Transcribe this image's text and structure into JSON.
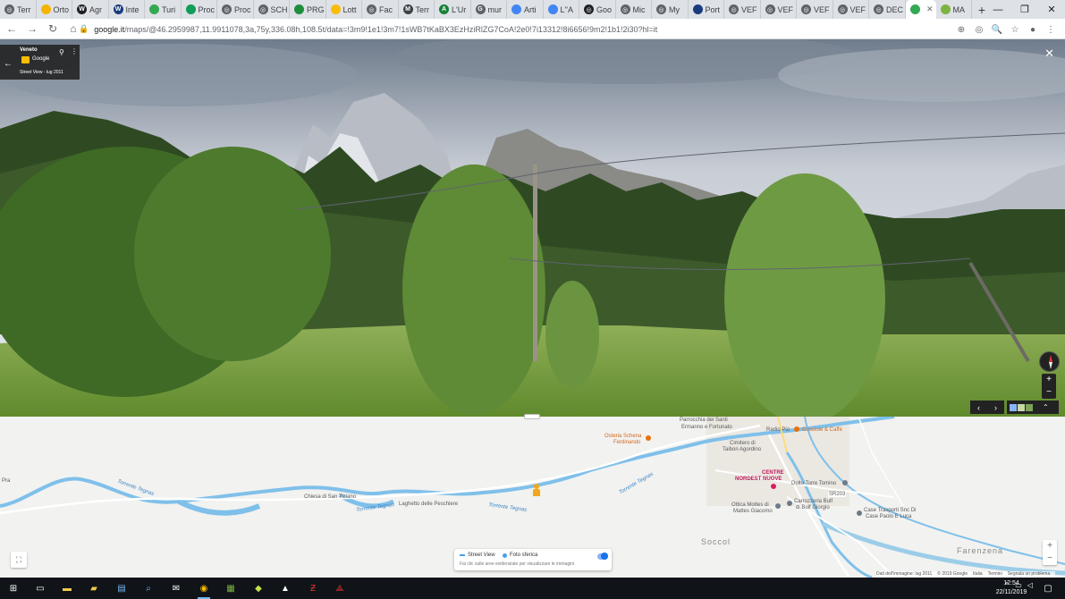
{
  "browser": {
    "tabs": [
      {
        "label": "Terr",
        "color": "#5f6368",
        "glyph": "◎"
      },
      {
        "label": "Orto",
        "color": "#f4b400",
        "glyph": ""
      },
      {
        "label": "Agr",
        "color": "#202124",
        "glyph": "W"
      },
      {
        "label": "Inte",
        "color": "#1a3b7d",
        "glyph": "W"
      },
      {
        "label": "Turi",
        "color": "#34a853",
        "glyph": ""
      },
      {
        "label": "Proc",
        "color": "#0f9d58",
        "glyph": ""
      },
      {
        "label": "Proc",
        "color": "#5f6368",
        "glyph": "◎"
      },
      {
        "label": "SCH",
        "color": "#5f6368",
        "glyph": "◎"
      },
      {
        "label": "PRG",
        "color": "#1e8e3e",
        "glyph": ""
      },
      {
        "label": "Lott",
        "color": "#fbbc04",
        "glyph": ""
      },
      {
        "label": "Fac",
        "color": "#5f6368",
        "glyph": "◎"
      },
      {
        "label": "Terr",
        "color": "#3c4043",
        "glyph": "M"
      },
      {
        "label": "L'Ur",
        "color": "#188038",
        "glyph": "A"
      },
      {
        "label": "mur",
        "color": "#5f6368",
        "glyph": "G"
      },
      {
        "label": "Arti",
        "color": "#4285f4",
        "glyph": ""
      },
      {
        "label": "L''A",
        "color": "#4285f4",
        "glyph": ""
      },
      {
        "label": "Goo",
        "color": "#202124",
        "glyph": "◎"
      },
      {
        "label": "Mic",
        "color": "#5f6368",
        "glyph": "◎"
      },
      {
        "label": "My",
        "color": "#5f6368",
        "glyph": "◎"
      },
      {
        "label": "Port",
        "color": "#1a3b7d",
        "glyph": ""
      },
      {
        "label": "VEF",
        "color": "#5f6368",
        "glyph": "◎"
      },
      {
        "label": "VEF",
        "color": "#5f6368",
        "glyph": "◎"
      },
      {
        "label": "VEF",
        "color": "#5f6368",
        "glyph": "◎"
      },
      {
        "label": "VEF",
        "color": "#5f6368",
        "glyph": "◎"
      },
      {
        "label": "DEC",
        "color": "#5f6368",
        "glyph": "◎"
      }
    ],
    "active_tab": {
      "label": "",
      "color": "#34a853"
    },
    "last_tab": {
      "label": "MA",
      "color": "#7cb342"
    },
    "new_tab_glyph": "+",
    "url_host": "google.it",
    "url_rest": "/maps/@46.2959987,11.9911078,3a,75y,336.08h,108.5t/data=!3m9!1e1!3m7!1sWB7tKaBX3EzHziRlZG7CoA!2e0!7i13312!8i6656!9m2!1b1!2i30?hl=it"
  },
  "streetview": {
    "place": "Veneto",
    "by": "Google",
    "date": "Street View - lug 2011"
  },
  "map": {
    "labels": {
      "pra": "Pra",
      "torrente_tegnas_1": "Torrente Tegnas",
      "chiesa": "Chiesa di San Tiziano",
      "torrente_tegnas_2": "Torrente Tegnas",
      "laghetto": "Laghetto delle Peschiere",
      "torrente_tegnas_3": "Torrente Tegnas",
      "torrente_tegnas_4": "Torrente Tegnas",
      "osteria_1": "Osteria Schena",
      "osteria_2": "Ferdinando",
      "parrocchia_1": "Parrocchia dei Santi",
      "parrocchia_2": "Ermanno e Fortunato",
      "cimitero_1": "Cimitero di",
      "cimitero_2": "Taibon Agordino",
      "radio": "Radio Più",
      "gocciole": "Gocciole & Caffè",
      "centre_1": "CENTRE",
      "centre_2": "NORDEST NUOVE",
      "dolto": "Dolto Torre Tomino",
      "sr203": "SR203",
      "bulf": "Carrozzeria Bulf",
      "bulf2": "di Bulf Giorgio",
      "mottes": "Ottica Mottes di",
      "mottes2": "Mattes Giacomo",
      "casetrasporti": "Case Trasporti Snc Di",
      "casetrasporti2": "Case Paolo E Luca",
      "socco": "Soccol",
      "farenzena": "Farenzena"
    },
    "legend": {
      "streetview": "Street View",
      "foto": "Foto sferica",
      "hint": "Fai clic sulle aree evidenziate per visualizzare le immagini"
    },
    "attribution": [
      "Dati dell'immagine: lug 2011",
      "© 2019 Google",
      "Italia",
      "Termini",
      "Segnala un problema"
    ]
  },
  "taskbar": {
    "time": "12:54",
    "date": "22/11/2019"
  },
  "colors": {
    "water": "#7fc0ea",
    "water_dark": "#4aa0e6",
    "map_bg": "#f2f2f0",
    "road": "#ffffff"
  }
}
